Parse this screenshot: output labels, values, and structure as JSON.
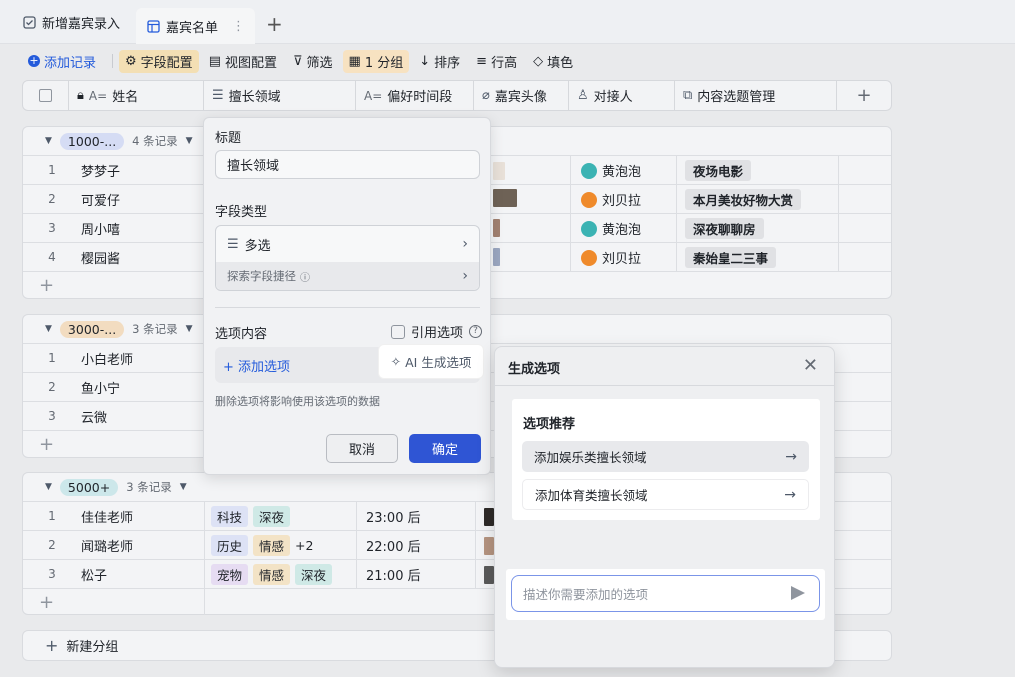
{
  "tabs": [
    {
      "label": "新增嘉宾录入",
      "icon": "form-icon"
    },
    {
      "label": "嘉宾名单",
      "icon": "table-icon",
      "more": "⋮"
    }
  ],
  "add_tab": "+",
  "toolbar": {
    "add_record": "添加记录",
    "field_config": "字段配置",
    "view_config": "视图配置",
    "filter": "筛选",
    "group": "1 分组",
    "sort": "排序",
    "row_height": "行高",
    "fill": "填色"
  },
  "columns": [
    {
      "label": "姓名",
      "icon": "lock-icon"
    },
    {
      "label": "擅长领域",
      "icon": "multiselect-icon"
    },
    {
      "label": "偏好时间段",
      "icon": "text-icon"
    },
    {
      "label": "嘉宾头像",
      "icon": "attachment-icon"
    },
    {
      "label": "对接人",
      "icon": "person-icon"
    },
    {
      "label": "内容选题管理",
      "icon": "link-icon"
    },
    {
      "label": "+"
    }
  ],
  "groups": [
    {
      "label": "1000-...",
      "count": "4 条记录",
      "color": "#d5dcf4",
      "rows": [
        {
          "num": "1",
          "name": "梦梦子",
          "contact": "黄泡泡",
          "topic": "夜场电影"
        },
        {
          "num": "2",
          "name": "可爱仔",
          "contact": "刘贝拉",
          "topic": "本月美妆好物大赏"
        },
        {
          "num": "3",
          "name": "周小嘻",
          "contact": "黄泡泡",
          "topic": "深夜聊聊房"
        },
        {
          "num": "4",
          "name": "樱园酱",
          "contact": "刘贝拉",
          "topic": "秦始皇二三事"
        }
      ]
    },
    {
      "label": "3000-...",
      "count": "3 条记录",
      "color": "#f2dcc0",
      "rows": [
        {
          "num": "1",
          "name": "小白老师"
        },
        {
          "num": "2",
          "name": "鱼小宁"
        },
        {
          "num": "3",
          "name": "云微"
        }
      ]
    },
    {
      "label": "5000+",
      "count": "3 条记录",
      "color": "#cce7ea",
      "rows": [
        {
          "num": "1",
          "name": "佳佳老师",
          "tags": [
            "科技",
            "深夜"
          ],
          "time": "23:00 后"
        },
        {
          "num": "2",
          "name": "闻璐老师",
          "tags": [
            "历史",
            "情感"
          ],
          "extra": "+2",
          "time": "22:00 后"
        },
        {
          "num": "3",
          "name": "松子",
          "tags": [
            "宠物",
            "情感",
            "深夜"
          ],
          "time": "21:00 后"
        }
      ]
    }
  ],
  "new_group": "新建分组",
  "field_panel": {
    "title_label": "标题",
    "title_value": "擅长领域",
    "type_label": "字段类型",
    "type_value": "多选",
    "shortcut": "探索字段捷径",
    "options_label": "选项内容",
    "ref_option": "引用选项",
    "add_option": "+ 添加选项",
    "ai_generate": "AI 生成选项",
    "hint": "删除选项将影响使用该选项的数据",
    "cancel": "取消",
    "ok": "确定"
  },
  "gen_dialog": {
    "title": "生成选项",
    "rec_title": "选项推荐",
    "items": [
      "添加娱乐类擅长领域",
      "添加体育类擅长领域"
    ],
    "placeholder": "描述你需要添加的选项"
  }
}
